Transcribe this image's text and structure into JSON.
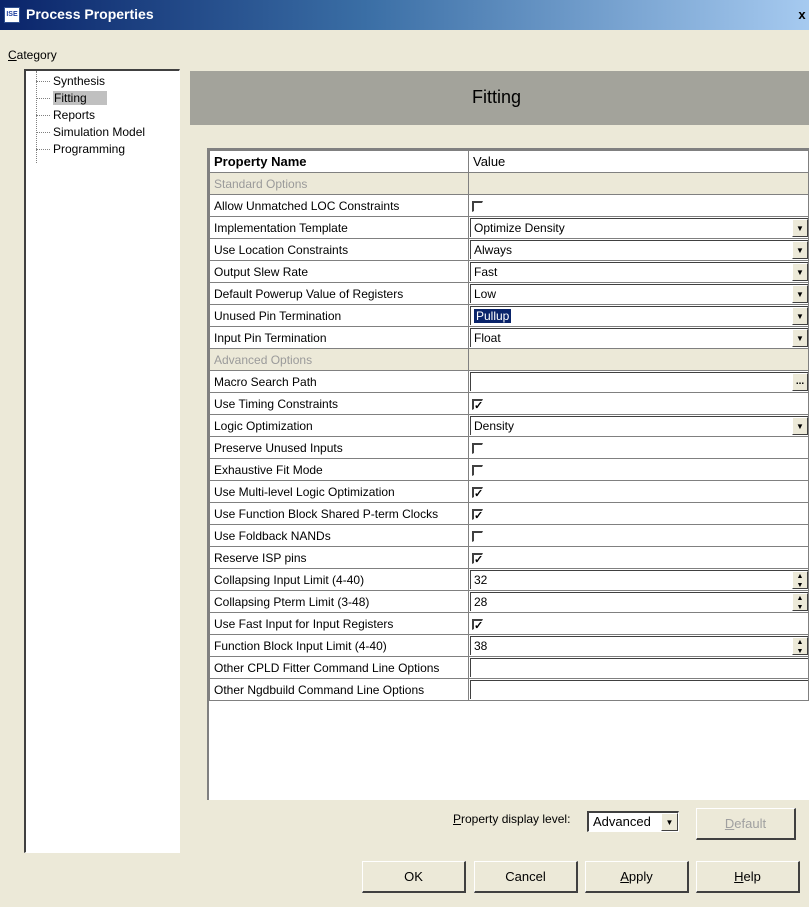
{
  "window": {
    "title": "Process Properties",
    "app_icon_text": "ISE",
    "close_glyph": "x"
  },
  "category": {
    "label_prefix": "C",
    "label_rest": "ategory",
    "items": [
      {
        "label": "Synthesis"
      },
      {
        "label": "Fitting"
      },
      {
        "label": "Reports"
      },
      {
        "label": "Simulation Model"
      },
      {
        "label": "Programming"
      }
    ],
    "selected": "Fitting"
  },
  "header": {
    "title": "Fitting"
  },
  "table": {
    "col_name": "Property Name",
    "col_value": "Value",
    "rows": [
      {
        "name": "Standard Options",
        "section": true
      },
      {
        "name": "Allow Unmatched LOC Constraints",
        "type": "checkbox",
        "checked": false
      },
      {
        "name": "Implementation Template",
        "type": "dropdown",
        "value": "Optimize Density"
      },
      {
        "name": "Use Location Constraints",
        "type": "dropdown",
        "value": "Always"
      },
      {
        "name": "Output Slew Rate",
        "type": "dropdown",
        "value": "Fast"
      },
      {
        "name": "Default Powerup Value of Registers",
        "type": "dropdown",
        "value": "Low"
      },
      {
        "name": "Unused Pin Termination",
        "type": "dropdown",
        "value": "Pullup",
        "highlighted": true
      },
      {
        "name": "Input Pin Termination",
        "type": "dropdown",
        "value": "Float"
      },
      {
        "name": "Advanced Options",
        "section": true
      },
      {
        "name": "Macro Search Path",
        "type": "browse",
        "value": "",
        "button_label": "..."
      },
      {
        "name": "Use Timing Constraints",
        "type": "checkbox",
        "checked": true
      },
      {
        "name": "Logic Optimization",
        "type": "dropdown",
        "value": "Density"
      },
      {
        "name": "Preserve Unused Inputs",
        "type": "checkbox",
        "checked": false
      },
      {
        "name": "Exhaustive Fit Mode",
        "type": "checkbox",
        "checked": false
      },
      {
        "name": "Use Multi-level Logic Optimization",
        "type": "checkbox",
        "checked": true
      },
      {
        "name": "Use Function Block Shared P-term Clocks",
        "type": "checkbox",
        "checked": true
      },
      {
        "name": "Use Foldback NANDs",
        "type": "checkbox",
        "checked": false
      },
      {
        "name": "Reserve ISP pins",
        "type": "checkbox",
        "checked": true
      },
      {
        "name": "Collapsing Input Limit (4-40)",
        "type": "spin",
        "value": "32"
      },
      {
        "name": "Collapsing Pterm Limit (3-48)",
        "type": "spin",
        "value": "28"
      },
      {
        "name": "Use Fast Input for Input Registers",
        "type": "checkbox",
        "checked": true
      },
      {
        "name": "Function Block Input Limit (4-40)",
        "type": "spin",
        "value": "38"
      },
      {
        "name": "Other CPLD Fitter Command Line Options",
        "type": "text",
        "value": ""
      },
      {
        "name": "Other Ngdbuild Command Line Options",
        "type": "text",
        "value": ""
      }
    ]
  },
  "display_level": {
    "label_prefix": "P",
    "label_rest": "roperty display level:",
    "value": "Advanced"
  },
  "buttons": {
    "default_prefix": "D",
    "default_rest": "efault",
    "ok": "OK",
    "cancel": "Cancel",
    "apply_prefix": "A",
    "apply_rest": "pply",
    "help_prefix": "H",
    "help_rest": "elp"
  },
  "glyphs": {
    "check": "✓",
    "dropdown": "▼",
    "spin_up": "▲",
    "spin_down": "▼"
  }
}
